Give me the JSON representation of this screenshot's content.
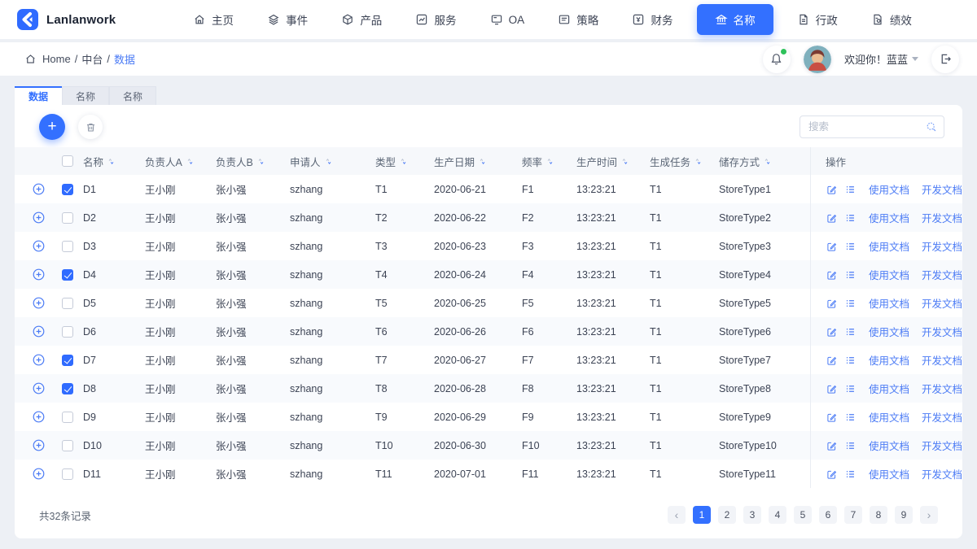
{
  "theme": {
    "primary": "#3370ff",
    "link": "#4b7bf5",
    "notification_dot": "#2fc25b",
    "checkbox": "#2f6bff"
  },
  "brand": {
    "name": "Lanlanwork"
  },
  "nav": {
    "items": [
      {
        "label": "主页",
        "icon": "home-icon",
        "active": false
      },
      {
        "label": "事件",
        "icon": "layers-icon",
        "active": false
      },
      {
        "label": "产品",
        "icon": "cube-icon",
        "active": false
      },
      {
        "label": "服务",
        "icon": "chart-icon",
        "active": false
      },
      {
        "label": "OA",
        "icon": "monitor-icon",
        "active": false
      },
      {
        "label": "策略",
        "icon": "card-list-icon",
        "active": false
      },
      {
        "label": "财务",
        "icon": "yuan-icon",
        "active": false
      },
      {
        "label": "名称",
        "icon": "bank-icon",
        "active": true
      },
      {
        "label": "行政",
        "icon": "document-icon",
        "active": false
      },
      {
        "label": "绩效",
        "icon": "document-gear-icon",
        "active": false
      }
    ]
  },
  "breadcrumb": {
    "items": [
      {
        "label": "Home"
      },
      {
        "label": "中台"
      },
      {
        "label": "数据",
        "active": true
      }
    ],
    "separator": "/"
  },
  "user": {
    "welcome": "欢迎你！蓝蓝"
  },
  "tabs": [
    {
      "label": "数据",
      "active": true
    },
    {
      "label": "名称",
      "active": false
    },
    {
      "label": "名称",
      "active": false
    }
  ],
  "toolbar": {
    "search_placeholder": "搜索"
  },
  "table": {
    "columns": [
      "名称",
      "负责人A",
      "负责人B",
      "申请人",
      "类型",
      "生产日期",
      "频率",
      "生产时间",
      "生成任务",
      "储存方式"
    ],
    "actions_column": "操作",
    "action_links": [
      "使用文档",
      "开发文档"
    ],
    "rows": [
      {
        "name": "D1",
        "ownerA": "王小刚",
        "ownerB": "张小强",
        "applicant": "szhang",
        "type": "T1",
        "date": "2020-06-21",
        "freq": "F1",
        "time": "13:23:21",
        "task": "T1",
        "store": "StoreType1",
        "checked": true
      },
      {
        "name": "D2",
        "ownerA": "王小刚",
        "ownerB": "张小强",
        "applicant": "szhang",
        "type": "T2",
        "date": "2020-06-22",
        "freq": "F2",
        "time": "13:23:21",
        "task": "T1",
        "store": "StoreType2",
        "checked": false
      },
      {
        "name": "D3",
        "ownerA": "王小刚",
        "ownerB": "张小强",
        "applicant": "szhang",
        "type": "T3",
        "date": "2020-06-23",
        "freq": "F3",
        "time": "13:23:21",
        "task": "T1",
        "store": "StoreType3",
        "checked": false
      },
      {
        "name": "D4",
        "ownerA": "王小刚",
        "ownerB": "张小强",
        "applicant": "szhang",
        "type": "T4",
        "date": "2020-06-24",
        "freq": "F4",
        "time": "13:23:21",
        "task": "T1",
        "store": "StoreType4",
        "checked": true
      },
      {
        "name": "D5",
        "ownerA": "王小刚",
        "ownerB": "张小强",
        "applicant": "szhang",
        "type": "T5",
        "date": "2020-06-25",
        "freq": "F5",
        "time": "13:23:21",
        "task": "T1",
        "store": "StoreType5",
        "checked": false
      },
      {
        "name": "D6",
        "ownerA": "王小刚",
        "ownerB": "张小强",
        "applicant": "szhang",
        "type": "T6",
        "date": "2020-06-26",
        "freq": "F6",
        "time": "13:23:21",
        "task": "T1",
        "store": "StoreType6",
        "checked": false
      },
      {
        "name": "D7",
        "ownerA": "王小刚",
        "ownerB": "张小强",
        "applicant": "szhang",
        "type": "T7",
        "date": "2020-06-27",
        "freq": "F7",
        "time": "13:23:21",
        "task": "T1",
        "store": "StoreType7",
        "checked": true
      },
      {
        "name": "D8",
        "ownerA": "王小刚",
        "ownerB": "张小强",
        "applicant": "szhang",
        "type": "T8",
        "date": "2020-06-28",
        "freq": "F8",
        "time": "13:23:21",
        "task": "T1",
        "store": "StoreType8",
        "checked": true
      },
      {
        "name": "D9",
        "ownerA": "王小刚",
        "ownerB": "张小强",
        "applicant": "szhang",
        "type": "T9",
        "date": "2020-06-29",
        "freq": "F9",
        "time": "13:23:21",
        "task": "T1",
        "store": "StoreType9",
        "checked": false
      },
      {
        "name": "D10",
        "ownerA": "王小刚",
        "ownerB": "张小强",
        "applicant": "szhang",
        "type": "T10",
        "date": "2020-06-30",
        "freq": "F10",
        "time": "13:23:21",
        "task": "T1",
        "store": "StoreType10",
        "checked": false
      },
      {
        "name": "D11",
        "ownerA": "王小刚",
        "ownerB": "张小强",
        "applicant": "szhang",
        "type": "T11",
        "date": "2020-07-01",
        "freq": "F11",
        "time": "13:23:21",
        "task": "T1",
        "store": "StoreType11",
        "checked": false
      }
    ]
  },
  "pagination": {
    "total_text": "共32条记录",
    "pages": [
      "1",
      "2",
      "3",
      "4",
      "5",
      "6",
      "7",
      "8",
      "9"
    ],
    "active_page": "1"
  }
}
